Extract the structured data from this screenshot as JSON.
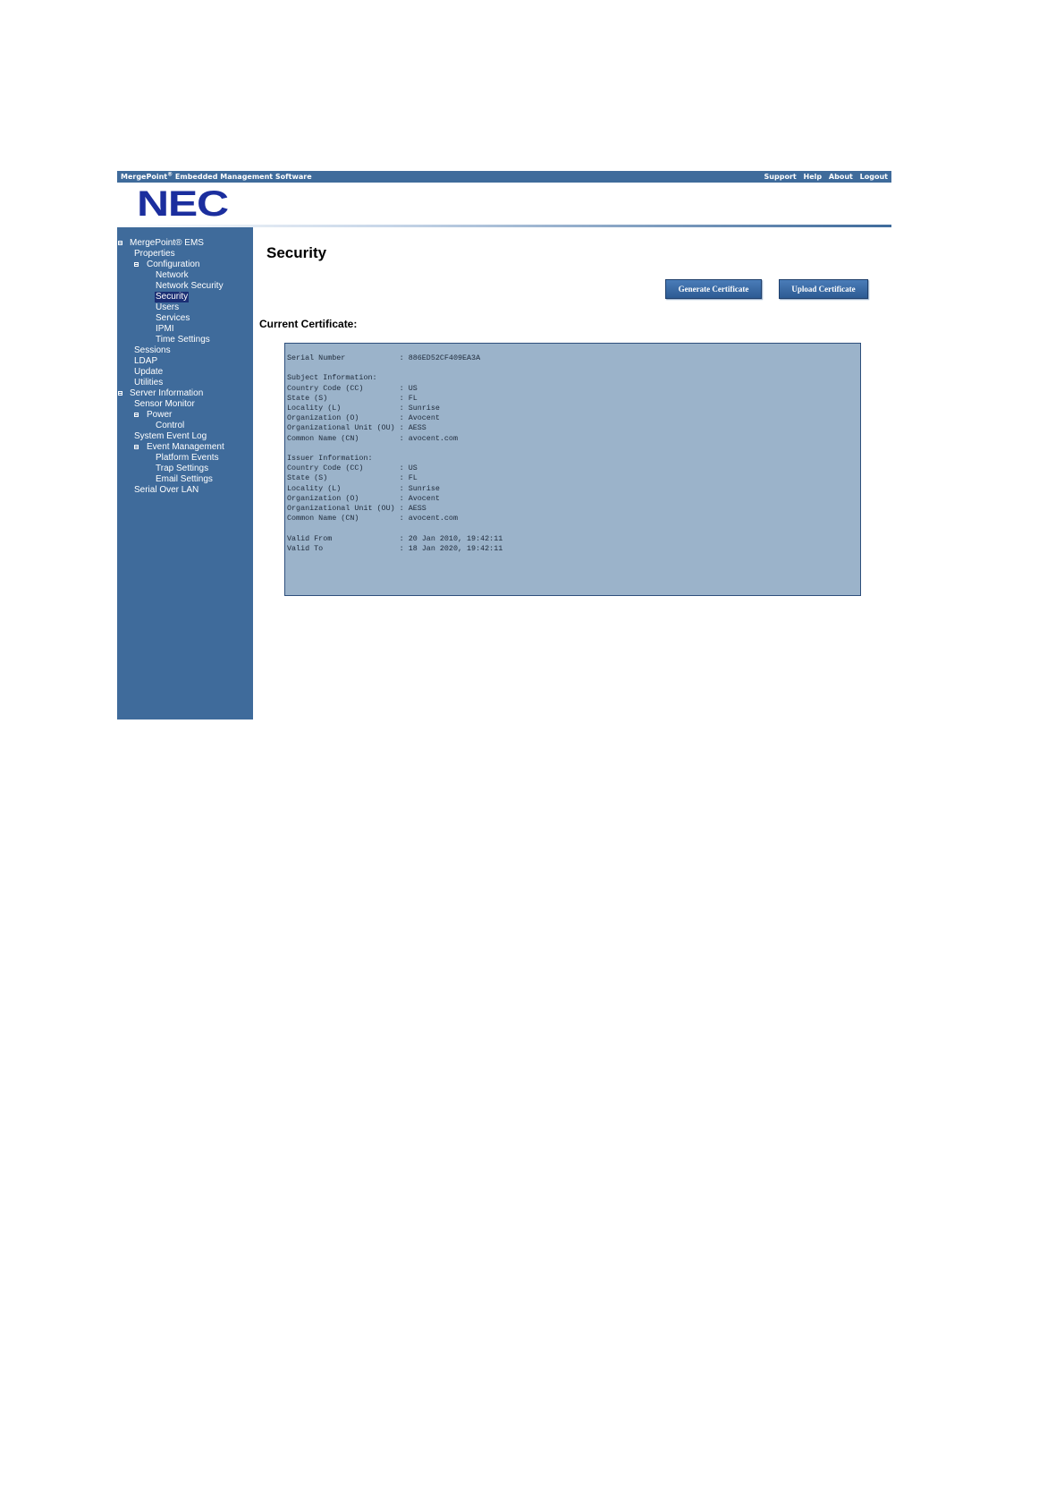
{
  "header": {
    "brand_main": "MergePoint",
    "brand_reg": "®",
    "brand_rest": " Embedded Management Software",
    "links": [
      "Support",
      "Help",
      "About",
      "Logout"
    ],
    "logo_text": "NEC"
  },
  "sidebar": {
    "items": [
      {
        "label": "MergePoint® EMS",
        "level": 0,
        "toggle": true
      },
      {
        "label": "Properties",
        "level": 1
      },
      {
        "label": "Configuration",
        "level": 1,
        "toggle": true
      },
      {
        "label": "Network",
        "level": 2
      },
      {
        "label": "Network Security",
        "level": 2
      },
      {
        "label": "Security",
        "level": 2,
        "selected": true
      },
      {
        "label": "Users",
        "level": 2
      },
      {
        "label": "Services",
        "level": 2
      },
      {
        "label": "IPMI",
        "level": 2
      },
      {
        "label": "Time Settings",
        "level": 2
      },
      {
        "label": "Sessions",
        "level": 1
      },
      {
        "label": "LDAP",
        "level": 1
      },
      {
        "label": "Update",
        "level": 1
      },
      {
        "label": "Utilities",
        "level": 1
      },
      {
        "label": "Server Information",
        "level": 0,
        "toggle": true
      },
      {
        "label": "Sensor Monitor",
        "level": 1
      },
      {
        "label": "Power",
        "level": 1,
        "toggle": true
      },
      {
        "label": "Control",
        "level": 2
      },
      {
        "label": "System Event Log",
        "level": 1
      },
      {
        "label": "Event Management",
        "level": 1,
        "toggle": true
      },
      {
        "label": "Platform Events",
        "level": 2
      },
      {
        "label": "Trap Settings",
        "level": 2
      },
      {
        "label": "Email Settings",
        "level": 2
      },
      {
        "label": "Serial Over LAN",
        "level": 1
      }
    ]
  },
  "main": {
    "title": "Security",
    "generate_button": "Generate Certificate",
    "upload_button": "Upload Certificate",
    "section_label": "Current Certificate:",
    "certificate_lines": [
      "Serial Number            : 886ED52CF409EA3A",
      "",
      "Subject Information:",
      "Country Code (CC)        : US",
      "State (S)                : FL",
      "Locality (L)             : Sunrise",
      "Organization (O)         : Avocent",
      "Organizational Unit (OU) : AESS",
      "Common Name (CN)         : avocent.com",
      "",
      "Issuer Information:",
      "Country Code (CC)        : US",
      "State (S)                : FL",
      "Locality (L)             : Sunrise",
      "Organization (O)         : Avocent",
      "Organizational Unit (OU) : AESS",
      "Common Name (CN)         : avocent.com",
      "",
      "Valid From               : 20 Jan 2010, 19:42:11",
      "Valid To                 : 18 Jan 2020, 19:42:11"
    ]
  },
  "colors": {
    "nav_blue": "#3f6b9b",
    "logo_blue": "#1b2e9e",
    "cert_bg": "#9bb3ca",
    "selected_bg": "#1b2f74"
  }
}
